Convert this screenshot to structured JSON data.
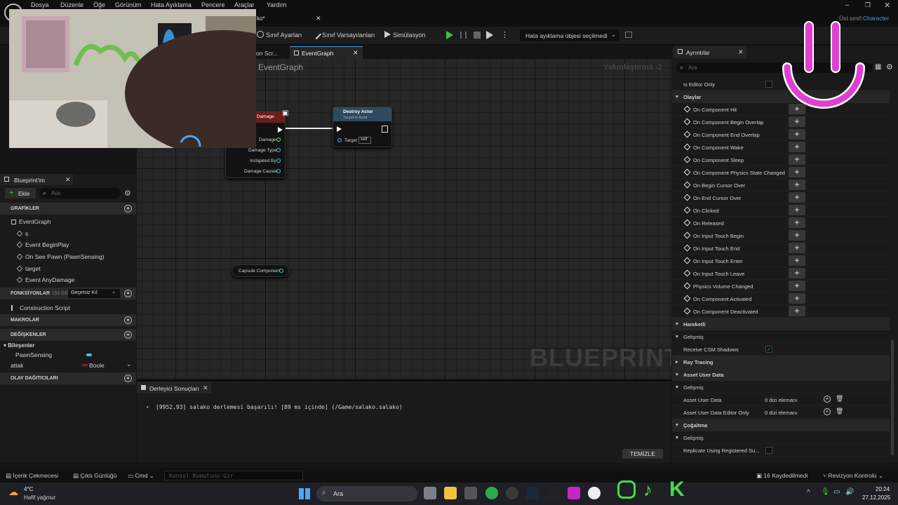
{
  "menu": [
    "Dosya",
    "Düzenle",
    "Öğe",
    "Görünüm",
    "Hata Ayıklama",
    "Pencere",
    "Araçlar",
    "Yardım"
  ],
  "tab_title": "ko*",
  "parent_class_label": "Üst sınıf:",
  "parent_class_value": "Character",
  "toolbar": {
    "class_settings": "Sınıf Ayarları",
    "class_defaults": "Sınıf Varsayılanları",
    "simulation": "Simülasyon",
    "debug_object": "Hata ayıklama objesi seçilmedi"
  },
  "graph_tabs": [
    "on Scr...",
    "EventGraph"
  ],
  "graph_title": "EventGraph",
  "zoom_label": "Yakınlaştırma -2",
  "watermark": "BLUEPRINT",
  "nodes": {
    "event_header": "Damage",
    "event_pins": [
      "Damage",
      "Damage Type",
      "Instigated By",
      "Damage Causer"
    ],
    "destroy_title": "Destroy Actor",
    "destroy_subtitle": "Target is Actor",
    "destroy_target_label": "Target",
    "destroy_target_value": "self",
    "capsule": "Capsule Component"
  },
  "my_blueprint": {
    "tab": "Blueprint'im",
    "add": "Ekle",
    "search_placeholder": "Ara",
    "graphs_hdr": "GRAFİKLER",
    "graphs": [
      "EventGraph",
      "s",
      "Event BeginPlay",
      "On See Pawn (PawnSensing)",
      "target",
      "Event AnyDamage"
    ],
    "functions_hdr": "FONKSİYONLAR",
    "functions_count": "(33 GEÇERS",
    "override_label": "Geçersiz Kıl",
    "functions": [
      "Construction Script"
    ],
    "macros_hdr": "MAKROLAR",
    "variables_hdr": "DEĞİŞKENLER",
    "components_hdr": "Bileşenler",
    "components": [
      "PawnSensing"
    ],
    "variables": [
      {
        "name": "attak",
        "type": "Boole"
      }
    ],
    "dispatchers_hdr": "OLAY DAĞITICILARI"
  },
  "compiler": {
    "tab": "Derleyici Sonuçları",
    "message": "[9952,93] salako derlemesi başarılı! [89 ms içinde] (/Game/salako.salako)",
    "clear": "TEMİZLE"
  },
  "details": {
    "tab": "Ayrıntılar",
    "search_placeholder": "Ara",
    "is_editor_only": "Is Editor Only",
    "events_hdr": "Olaylar",
    "events": [
      "On Component Hit",
      "On Component Begin Overlap",
      "On Component End Overlap",
      "On Component Wake",
      "On Component Sleep",
      "On Component Physics State Changed",
      "On Begin Cursor Over",
      "On End Cursor Over",
      "On Clicked",
      "On Released",
      "On Input Touch Begin",
      "On Input Touch End",
      "On Input Touch Enter",
      "On Input Touch Leave",
      "Physics Volume Changed",
      "On Component Activated",
      "On Component Deactivated"
    ],
    "movement_hdr": "Hareketli",
    "advanced": "Gelişmiş",
    "receive_csm": "Receive CSM Shadows",
    "ray_tracing_hdr": "Ray Tracing",
    "asset_user_data_hdr": "Asset User Data",
    "asset_user_data": "Asset User Data",
    "asset_user_data_editor": "Asset User Data Editor Only",
    "array_elements": "0 dizi elemanı",
    "replication_hdr": "Çoğaltma",
    "replicate_registered": "Replicate Using Registered Su..."
  },
  "statusbar": {
    "content_drawer": "İçerik Çekmecesi",
    "output_log": "Çıktı Günlüğü",
    "cmd": "Cmd",
    "console_placeholder": "Konsol Komutunu Gir",
    "saved": "16 Kaydedilmedi",
    "revision": "Revizyon Kontrolü"
  },
  "taskbar": {
    "temp": "4°C",
    "weather": "Hafif yağmur",
    "search": "Ara",
    "time": "20:24",
    "date": "27.12.2025"
  },
  "colors": {
    "accent": "#3aa0e8",
    "play": "#3fc33f",
    "overlay_magenta": "#e040d0"
  }
}
